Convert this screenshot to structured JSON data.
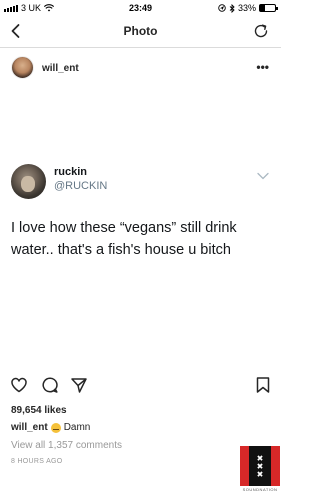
{
  "status_bar": {
    "carrier": "3 UK",
    "time": "23:49",
    "battery_text": "33%",
    "battery_level": 0.33,
    "icons": [
      "signal-icon",
      "wifi-icon",
      "location-icon",
      "bluetooth-icon",
      "battery-icon"
    ]
  },
  "nav": {
    "title": "Photo",
    "icons": [
      "back-chevron-icon",
      "refresh-icon"
    ]
  },
  "post": {
    "username": "will_ent",
    "more_label": "•••"
  },
  "tweet": {
    "name": "ruckin",
    "handle": "@RUCKIN",
    "text": "I love how these “vegans” still drink water.. that's a fish's house u bitch"
  },
  "footer": {
    "likes": "89,654 likes",
    "caption_user": "will_ent",
    "caption_text": "Damn",
    "view_all": "View all 1,357 comments",
    "time": "8 HOURS AGO",
    "badge_text": "SOUNDNATION",
    "icons": [
      "heart-icon",
      "comment-icon",
      "share-icon",
      "bookmark-icon"
    ]
  }
}
